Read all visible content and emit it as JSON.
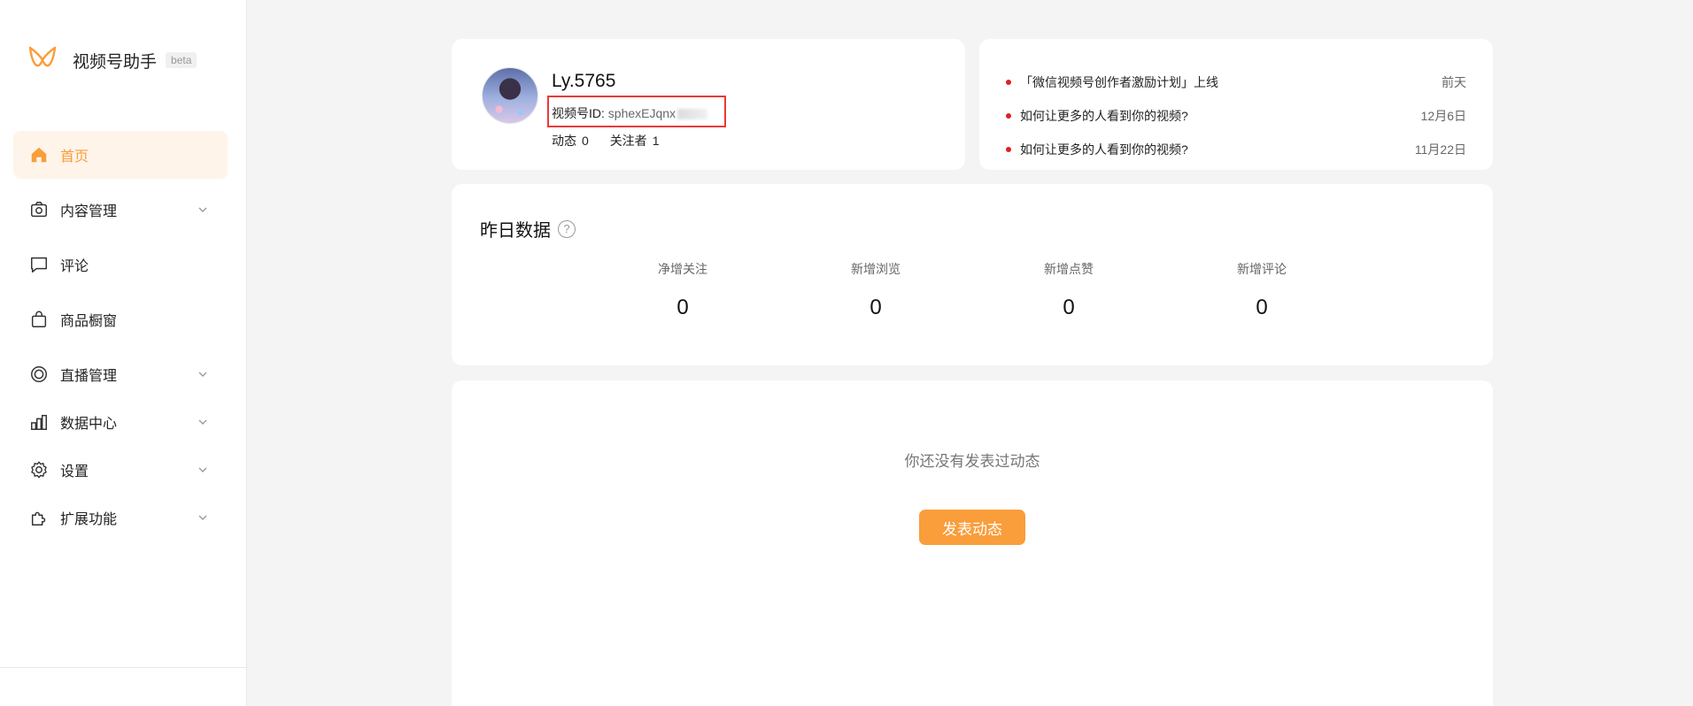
{
  "app": {
    "title": "视频号助手",
    "badge": "beta",
    "accent": "#fa9d3b"
  },
  "sidebar": {
    "items": [
      {
        "label": "首页",
        "icon": "home-icon",
        "active": true
      },
      {
        "label": "内容管理",
        "icon": "camera-icon",
        "expandable": true
      },
      {
        "label": "评论",
        "icon": "comment-icon"
      },
      {
        "label": "商品橱窗",
        "icon": "shopping-bag-icon"
      },
      {
        "label": "直播管理",
        "icon": "live-icon",
        "expandable": true
      },
      {
        "label": "数据中心",
        "icon": "chart-icon",
        "expandable": true
      },
      {
        "label": "设置",
        "icon": "gear-icon",
        "expandable": true
      },
      {
        "label": "扩展功能",
        "icon": "puzzle-icon",
        "expandable": true
      }
    ]
  },
  "profile": {
    "nickname": "Ly.5765",
    "id_label": "视频号ID: ",
    "id_value": "sphexEJqnx",
    "posts_label": "动态",
    "posts_count": "0",
    "followers_label": "关注者",
    "followers_count": "1",
    "highlight_color": "#e83a3a"
  },
  "news": [
    {
      "title": "「微信视频号创作者激励计划」上线",
      "date": "前天"
    },
    {
      "title": "如何让更多的人看到你的视频?",
      "date": "12月6日"
    },
    {
      "title": "如何让更多的人看到你的视频?",
      "date": "11月22日"
    }
  ],
  "stats": {
    "title": "昨日数据",
    "help": "?",
    "items": [
      {
        "label": "净增关注",
        "value": "0"
      },
      {
        "label": "新增浏览",
        "value": "0"
      },
      {
        "label": "新增点赞",
        "value": "0"
      },
      {
        "label": "新增评论",
        "value": "0"
      }
    ]
  },
  "feed": {
    "empty_text": "你还没有发表过动态",
    "post_button": "发表动态"
  }
}
